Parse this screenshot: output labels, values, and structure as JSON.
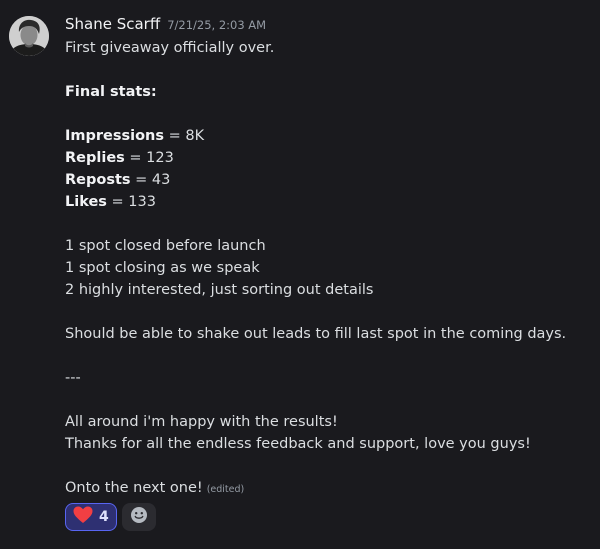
{
  "message": {
    "author": "Shane Scarff",
    "timestamp": "7/21/25, 2:03 AM",
    "edited_label": "(edited)",
    "lines": {
      "l1": "First giveaway officially over.",
      "l2_bold": "Final stats:",
      "impressions_label": "Impressions",
      "impressions_value": " = 8K",
      "replies_label": "Replies",
      "replies_value": " = 123",
      "reposts_label": "Reposts",
      "reposts_value": " = 43",
      "likes_label": "Likes",
      "likes_value": " = 133",
      "spot1": "1 spot closed before launch",
      "spot2": "1 spot closing as we speak",
      "spot3": "2 highly interested, just sorting out details",
      "leads": "Should be able to shake out leads to fill last spot in the coming days.",
      "divider": "---",
      "happy": "All around i'm happy with the results!",
      "thanks": "Thanks for all the endless feedback and support, love you guys!",
      "next": "Onto the next one!"
    }
  },
  "reactions": [
    {
      "icon": "heart-icon",
      "count": "4"
    }
  ],
  "colors": {
    "background": "#1a1a1e",
    "text": "#dbdee1",
    "muted": "#949ba4",
    "reaction_border": "#5865f2",
    "reaction_bg": "#2e3072",
    "heart": "#f23f43"
  }
}
